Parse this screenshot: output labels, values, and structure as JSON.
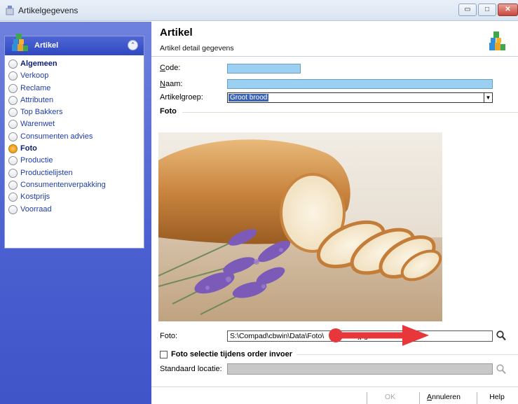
{
  "window": {
    "title": "Artikelgegevens",
    "minimize_label": "▭",
    "maximize_label": "□",
    "close_label": "✕"
  },
  "sidebar": {
    "group_title": "Artikel",
    "collapse_glyph": "⌃",
    "items": [
      {
        "label": "Algemeen",
        "bold": true,
        "selected": false
      },
      {
        "label": "Verkoop",
        "bold": false,
        "selected": false
      },
      {
        "label": "Reclame",
        "bold": false,
        "selected": false
      },
      {
        "label": "Attributen",
        "bold": false,
        "selected": false
      },
      {
        "label": "Top Bakkers",
        "bold": false,
        "selected": false
      },
      {
        "label": "Warenwet",
        "bold": false,
        "selected": false
      },
      {
        "label": "Consumenten advies",
        "bold": false,
        "selected": false
      },
      {
        "label": "Foto",
        "bold": true,
        "selected": true
      },
      {
        "label": "Productie",
        "bold": false,
        "selected": false
      },
      {
        "label": "Productielijsten",
        "bold": false,
        "selected": false
      },
      {
        "label": "Consumentenverpakking",
        "bold": false,
        "selected": false
      },
      {
        "label": "Kostprijs",
        "bold": false,
        "selected": false
      },
      {
        "label": "Voorraad",
        "bold": false,
        "selected": false
      }
    ]
  },
  "header": {
    "title": "Artikel",
    "subtitle": "Artikel detail gegevens"
  },
  "form": {
    "code_label_underline": "C",
    "code_label_rest": "ode:",
    "code_value": "",
    "naam_label_underline": "N",
    "naam_label_rest": "aam:",
    "naam_value": "",
    "groep_label": "Artikelgroep:",
    "groep_value": "Groot brood",
    "groep_arrow": "▼"
  },
  "foto_section": {
    "title": "Foto",
    "foto_label": "Foto:",
    "foto_path": "S:\\Compad\\cbwin\\Data\\Foto\\",
    "foto_path_tail": "...jpg",
    "checkbox_label": "Foto selectie tijdens order invoer",
    "checkbox_checked": false,
    "standaard_label": "Standaard locatie:",
    "standaard_value": ""
  },
  "footer": {
    "ok_label": "OK",
    "cancel_label_underline": "A",
    "cancel_label_rest": "nnuleren",
    "help_label": "Help"
  },
  "colors": {
    "sidebar_bg": "#4a5fd0",
    "input_blue": "#9bd0f2",
    "selection": "#3a63b6",
    "arrow_red": "#e8373a"
  }
}
